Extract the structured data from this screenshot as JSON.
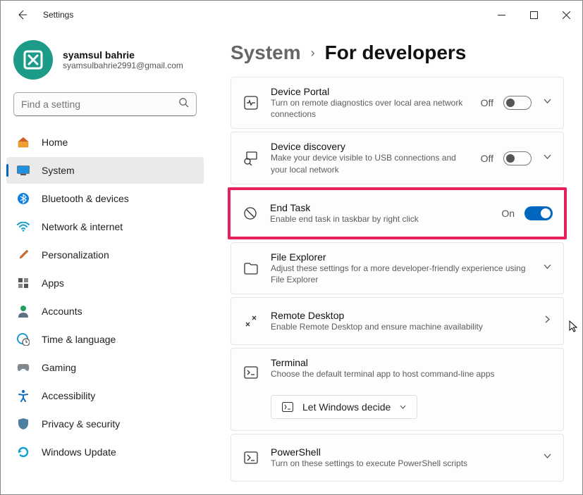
{
  "window": {
    "title": "Settings"
  },
  "profile": {
    "name": "syamsul bahrie",
    "email": "syamsulbahrie2991@gmail.com"
  },
  "search": {
    "placeholder": "Find a setting"
  },
  "nav": {
    "items": [
      {
        "label": "Home"
      },
      {
        "label": "System"
      },
      {
        "label": "Bluetooth & devices"
      },
      {
        "label": "Network & internet"
      },
      {
        "label": "Personalization"
      },
      {
        "label": "Apps"
      },
      {
        "label": "Accounts"
      },
      {
        "label": "Time & language"
      },
      {
        "label": "Gaming"
      },
      {
        "label": "Accessibility"
      },
      {
        "label": "Privacy & security"
      },
      {
        "label": "Windows Update"
      }
    ]
  },
  "breadcrumb": {
    "parent": "System",
    "current": "For developers"
  },
  "cards": {
    "device_portal": {
      "title": "Device Portal",
      "desc": "Turn on remote diagnostics over local area network connections",
      "status": "Off"
    },
    "device_discovery": {
      "title": "Device discovery",
      "desc": "Make your device visible to USB connections and your local network",
      "status": "Off"
    },
    "end_task": {
      "title": "End Task",
      "desc": "Enable end task in taskbar by right click",
      "status": "On"
    },
    "file_explorer": {
      "title": "File Explorer",
      "desc": "Adjust these settings for a more developer-friendly experience using File Explorer"
    },
    "remote_desktop": {
      "title": "Remote Desktop",
      "desc": "Enable Remote Desktop and ensure machine availability"
    },
    "terminal": {
      "title": "Terminal",
      "desc": "Choose the default terminal app to host command-line apps",
      "dropdown": "Let Windows decide"
    },
    "powershell": {
      "title": "PowerShell",
      "desc": "Turn on these settings to execute PowerShell scripts"
    }
  }
}
